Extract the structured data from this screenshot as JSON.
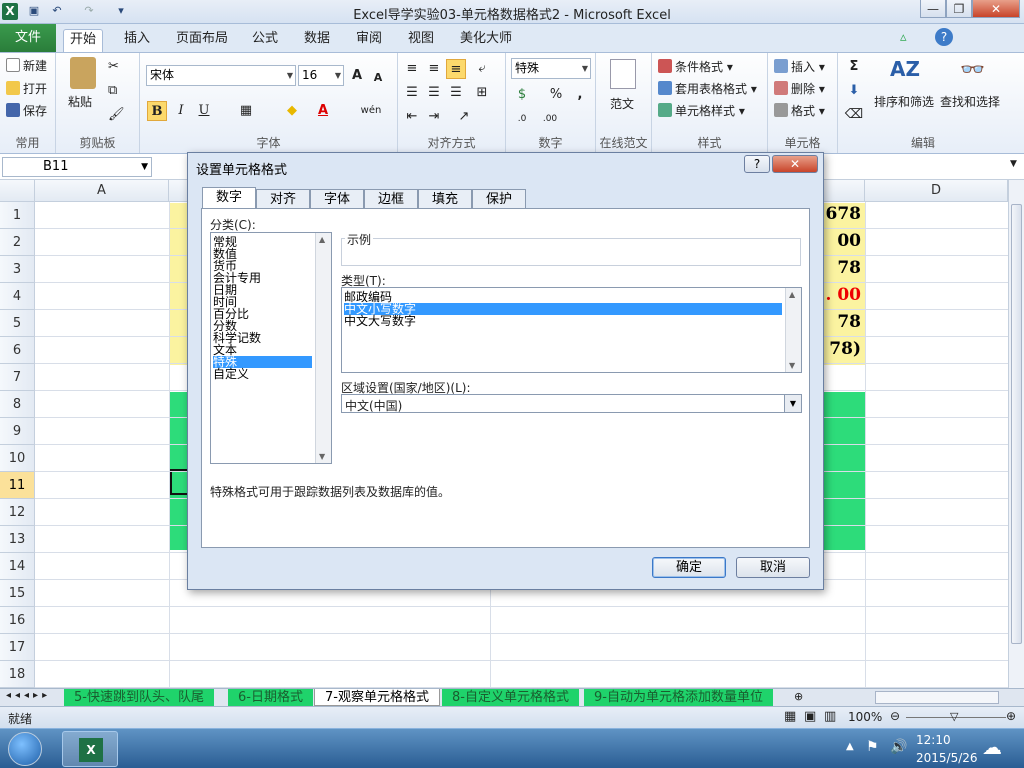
{
  "window": {
    "title": "Excel导学实验03-单元格数据格式2 - Microsoft Excel",
    "min": "—",
    "restore": "❐",
    "close": "✕"
  },
  "ribbon_tabs": {
    "file": "文件",
    "items": [
      "开始",
      "插入",
      "页面布局",
      "公式",
      "数据",
      "审阅",
      "视图",
      "美化大师"
    ]
  },
  "ribbon": {
    "common": {
      "label": "常用",
      "new": "新建",
      "open": "打开",
      "save": "保存"
    },
    "clipboard": {
      "label": "剪贴板",
      "paste": "粘贴"
    },
    "font": {
      "label": "字体",
      "name": "宋体",
      "size": "16",
      "grow": "A",
      "shrink": "A",
      "bold": "B",
      "italic": "I",
      "underline": "U",
      "wen": "wén"
    },
    "align": {
      "label": "对齐方式"
    },
    "number": {
      "label": "数字",
      "format": "特殊",
      "pct": "%",
      "comma": ","
    },
    "template": {
      "label": "在线范文",
      "btn": "范文"
    },
    "styles": {
      "label": "样式",
      "cond": "条件格式",
      "table": "套用表格格式",
      "cell": "单元格样式"
    },
    "cells": {
      "label": "单元格",
      "insert": "插入",
      "delete": "删除",
      "format": "格式"
    },
    "editing": {
      "label": "编辑",
      "sort": "排序和筛选",
      "find": "查找和选择",
      "sigma": "Σ"
    }
  },
  "formula_bar": {
    "name_box": "B11"
  },
  "sheet": {
    "col_headers": [
      "A",
      "D"
    ],
    "rows": [
      "1",
      "2",
      "3",
      "4",
      "5",
      "6",
      "7",
      "8",
      "9",
      "10",
      "11",
      "12",
      "13",
      "14",
      "15",
      "16",
      "17",
      "18"
    ],
    "selected_row": "11",
    "right_cells": [
      "678",
      "00",
      "78",
      ". 00",
      "78",
      "78)"
    ]
  },
  "sheet_tabs": [
    "5-快速跳到队头、队尾",
    "6-日期格式",
    "7-观察单元格格式",
    "8-自定义单元格格式",
    "9-自动为单元格添加数量单位"
  ],
  "status": {
    "ready": "就绪",
    "zoom": "100%"
  },
  "taskbar": {
    "time": "12:10",
    "date": "2015/5/26"
  },
  "dialog": {
    "title": "设置单元格格式",
    "help": "?",
    "close": "✕",
    "tabs": [
      "数字",
      "对齐",
      "字体",
      "边框",
      "填充",
      "保护"
    ],
    "category_label": "分类(C):",
    "categories": [
      "常规",
      "数值",
      "货币",
      "会计专用",
      "日期",
      "时间",
      "百分比",
      "分数",
      "科学记数",
      "文本",
      "特殊",
      "自定义"
    ],
    "selected_category": "特殊",
    "sample_label": "示例",
    "type_label": "类型(T):",
    "types": [
      "邮政编码",
      "中文小写数字",
      "中文大写数字"
    ],
    "selected_type": "中文小写数字",
    "locale_label": "区域设置(国家/地区)(L):",
    "locale_value": "中文(中国)",
    "description": "特殊格式可用于跟踪数据列表及数据库的值。",
    "ok": "确定",
    "cancel": "取消"
  },
  "colors": {
    "accent_green": "#2a7d3a",
    "yellow_cell": "#fbf3a0",
    "green_cell": "#2ddc7a",
    "selection": "#3399ff"
  }
}
